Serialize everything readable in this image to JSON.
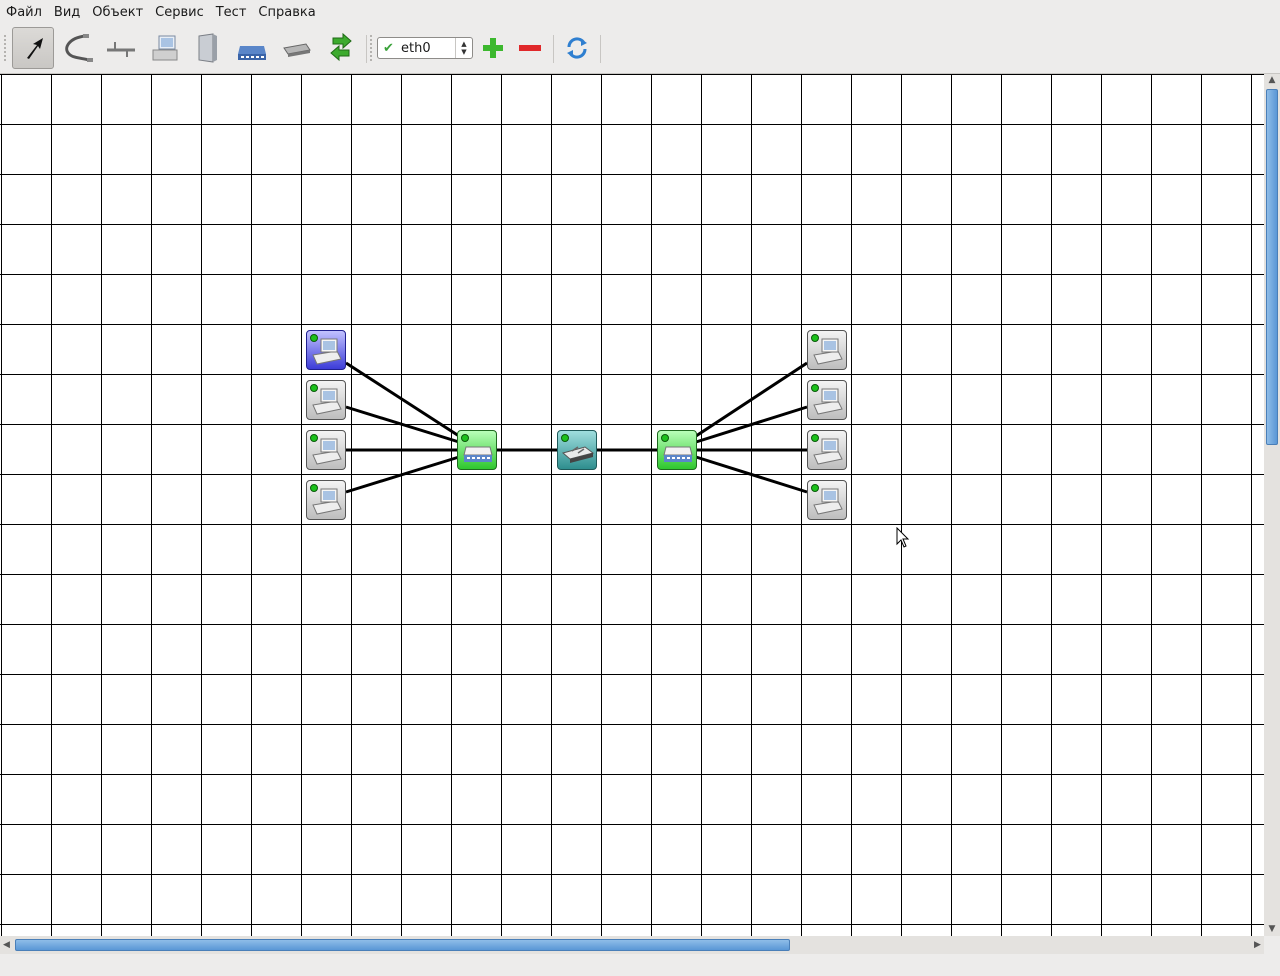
{
  "menu": {
    "items": [
      "Файл",
      "Вид",
      "Объект",
      "Сервис",
      "Тест",
      "Справка"
    ]
  },
  "toolbar": {
    "tools": [
      {
        "name": "pointer-tool",
        "icon": "arrow-cursor-icon",
        "active": true
      },
      {
        "name": "cable-tool",
        "icon": "cable-icon",
        "active": false
      },
      {
        "name": "bus-tool",
        "icon": "bus-icon",
        "active": false
      },
      {
        "name": "computer-tool",
        "icon": "computer-icon",
        "active": false
      },
      {
        "name": "server-tool",
        "icon": "server-icon",
        "active": false
      },
      {
        "name": "switch-tool",
        "icon": "switch-icon",
        "active": false
      },
      {
        "name": "router-tool",
        "icon": "router-icon",
        "active": false
      },
      {
        "name": "send-data-tool",
        "icon": "exchange-arrows-icon",
        "active": false
      }
    ],
    "interface_select": {
      "value": "eth0",
      "status": "check-icon"
    },
    "add_icon": "plus-icon",
    "remove_icon": "minus-icon",
    "refresh_icon": "refresh-icon"
  },
  "network": {
    "devices": [
      {
        "id": "pc-l1",
        "type": "computer",
        "selected": true
      },
      {
        "id": "pc-l2",
        "type": "computer",
        "selected": false
      },
      {
        "id": "pc-l3",
        "type": "computer",
        "selected": false
      },
      {
        "id": "pc-l4",
        "type": "computer",
        "selected": false
      },
      {
        "id": "switch-left",
        "type": "switch",
        "selected": false
      },
      {
        "id": "router-center",
        "type": "router",
        "selected": false
      },
      {
        "id": "switch-right",
        "type": "switch",
        "selected": false
      },
      {
        "id": "pc-r1",
        "type": "computer",
        "selected": false
      },
      {
        "id": "pc-r2",
        "type": "computer",
        "selected": false
      },
      {
        "id": "pc-r3",
        "type": "computer",
        "selected": false
      },
      {
        "id": "pc-r4",
        "type": "computer",
        "selected": false
      }
    ],
    "links": [
      [
        "pc-l1",
        "switch-left"
      ],
      [
        "pc-l2",
        "switch-left"
      ],
      [
        "pc-l3",
        "switch-left"
      ],
      [
        "pc-l4",
        "switch-left"
      ],
      [
        "switch-left",
        "router-center"
      ],
      [
        "router-center",
        "switch-right"
      ],
      [
        "switch-right",
        "pc-r1"
      ],
      [
        "switch-right",
        "pc-r2"
      ],
      [
        "switch-right",
        "pc-r3"
      ],
      [
        "switch-right",
        "pc-r4"
      ]
    ]
  },
  "colors": {
    "switch": "#2ec72e",
    "router": "#2e8e8e",
    "selected": "#3c3cd8",
    "led": "#1cc11c",
    "scroll_thumb": "#5a97d6"
  }
}
